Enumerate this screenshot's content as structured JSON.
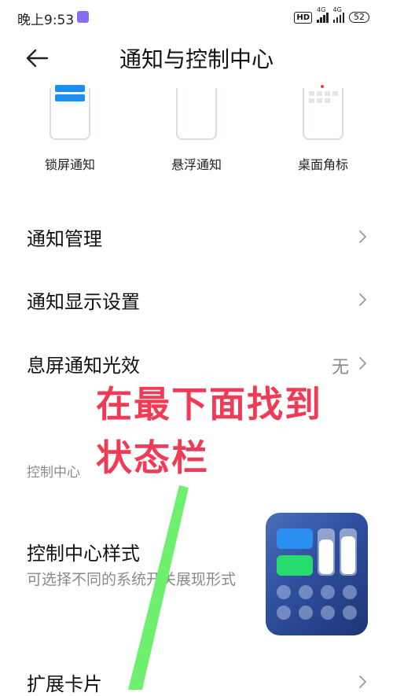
{
  "status_bar": {
    "time": "晚上9:53",
    "hd": "HD",
    "network": "4G",
    "battery": "52"
  },
  "header": {
    "title": "通知与控制中心",
    "back_icon": "arrow-left-icon"
  },
  "modes": [
    {
      "label": "锁屏通知"
    },
    {
      "label": "悬浮通知"
    },
    {
      "label": "桌面角标"
    }
  ],
  "menu": {
    "notification_management": "通知管理",
    "notification_display": "通知显示设置",
    "screen_off_light": "息屏通知光效",
    "screen_off_light_value": "无",
    "section_label": "控制中心",
    "control_center_style": "控制中心样式",
    "control_center_style_desc": "可选择不同的系统开关展现形式",
    "expand_cards": "扩展卡片"
  },
  "overlay": {
    "line1": "在最下面找到",
    "line2": "状态栏"
  },
  "colors": {
    "accent_blue": "#1b8fef",
    "overlay_red": "#ef3b55",
    "arrow_green": "#6ef06e"
  }
}
